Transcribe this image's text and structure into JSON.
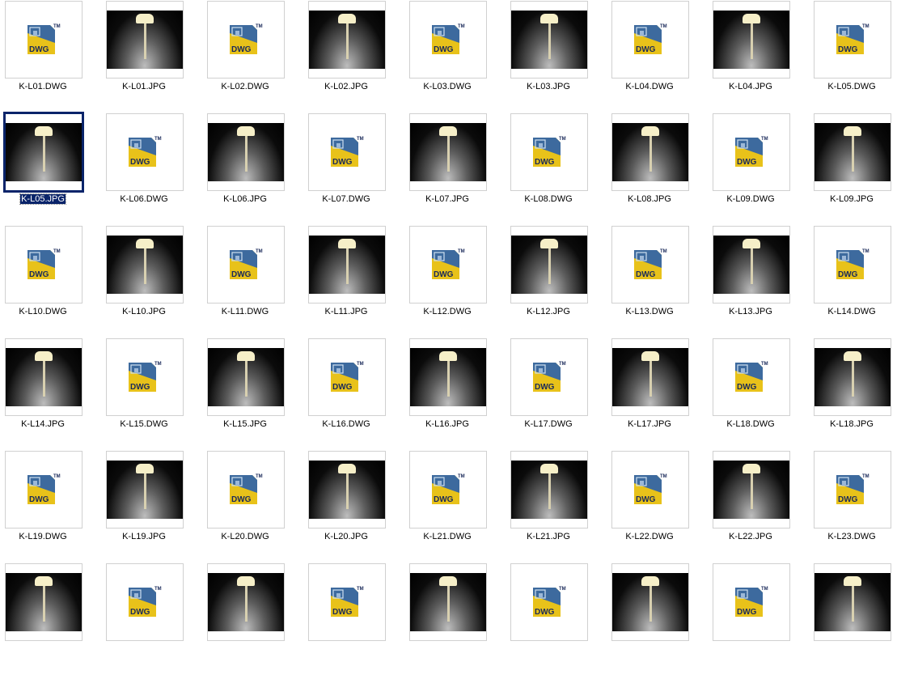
{
  "selected_index": 9,
  "items": [
    {
      "label": "K-L01.DWG",
      "type": "dwg"
    },
    {
      "label": "K-L01.JPG",
      "type": "jpg"
    },
    {
      "label": "K-L02.DWG",
      "type": "dwg"
    },
    {
      "label": "K-L02.JPG",
      "type": "jpg"
    },
    {
      "label": "K-L03.DWG",
      "type": "dwg"
    },
    {
      "label": "K-L03.JPG",
      "type": "jpg"
    },
    {
      "label": "K-L04.DWG",
      "type": "dwg"
    },
    {
      "label": "K-L04.JPG",
      "type": "jpg"
    },
    {
      "label": "K-L05.DWG",
      "type": "dwg"
    },
    {
      "label": "K-L05.JPG",
      "type": "jpg"
    },
    {
      "label": "K-L06.DWG",
      "type": "dwg"
    },
    {
      "label": "K-L06.JPG",
      "type": "jpg"
    },
    {
      "label": "K-L07.DWG",
      "type": "dwg"
    },
    {
      "label": "K-L07.JPG",
      "type": "jpg"
    },
    {
      "label": "K-L08.DWG",
      "type": "dwg"
    },
    {
      "label": "K-L08.JPG",
      "type": "jpg"
    },
    {
      "label": "K-L09.DWG",
      "type": "dwg"
    },
    {
      "label": "K-L09.JPG",
      "type": "jpg"
    },
    {
      "label": "K-L10.DWG",
      "type": "dwg"
    },
    {
      "label": "K-L10.JPG",
      "type": "jpg"
    },
    {
      "label": "K-L11.DWG",
      "type": "dwg"
    },
    {
      "label": "K-L11.JPG",
      "type": "jpg"
    },
    {
      "label": "K-L12.DWG",
      "type": "dwg"
    },
    {
      "label": "K-L12.JPG",
      "type": "jpg"
    },
    {
      "label": "K-L13.DWG",
      "type": "dwg"
    },
    {
      "label": "K-L13.JPG",
      "type": "jpg"
    },
    {
      "label": "K-L14.DWG",
      "type": "dwg"
    },
    {
      "label": "K-L14.JPG",
      "type": "jpg"
    },
    {
      "label": "K-L15.DWG",
      "type": "dwg"
    },
    {
      "label": "K-L15.JPG",
      "type": "jpg"
    },
    {
      "label": "K-L16.DWG",
      "type": "dwg"
    },
    {
      "label": "K-L16.JPG",
      "type": "jpg"
    },
    {
      "label": "K-L17.DWG",
      "type": "dwg"
    },
    {
      "label": "K-L17.JPG",
      "type": "jpg"
    },
    {
      "label": "K-L18.DWG",
      "type": "dwg"
    },
    {
      "label": "K-L18.JPG",
      "type": "jpg"
    },
    {
      "label": "K-L19.DWG",
      "type": "dwg"
    },
    {
      "label": "K-L19.JPG",
      "type": "jpg"
    },
    {
      "label": "K-L20.DWG",
      "type": "dwg"
    },
    {
      "label": "K-L20.JPG",
      "type": "jpg"
    },
    {
      "label": "K-L21.DWG",
      "type": "dwg"
    },
    {
      "label": "K-L21.JPG",
      "type": "jpg"
    },
    {
      "label": "K-L22.DWG",
      "type": "dwg"
    },
    {
      "label": "K-L22.JPG",
      "type": "jpg"
    },
    {
      "label": "K-L23.DWG",
      "type": "dwg"
    },
    {
      "type": "jpg"
    },
    {
      "type": "dwg"
    },
    {
      "type": "jpg"
    },
    {
      "type": "dwg"
    },
    {
      "type": "jpg"
    },
    {
      "type": "dwg"
    },
    {
      "type": "jpg"
    },
    {
      "type": "dwg"
    },
    {
      "type": "jpg"
    }
  ],
  "dwg_icon_text": "DWG",
  "dwg_icon_tm": "TM"
}
